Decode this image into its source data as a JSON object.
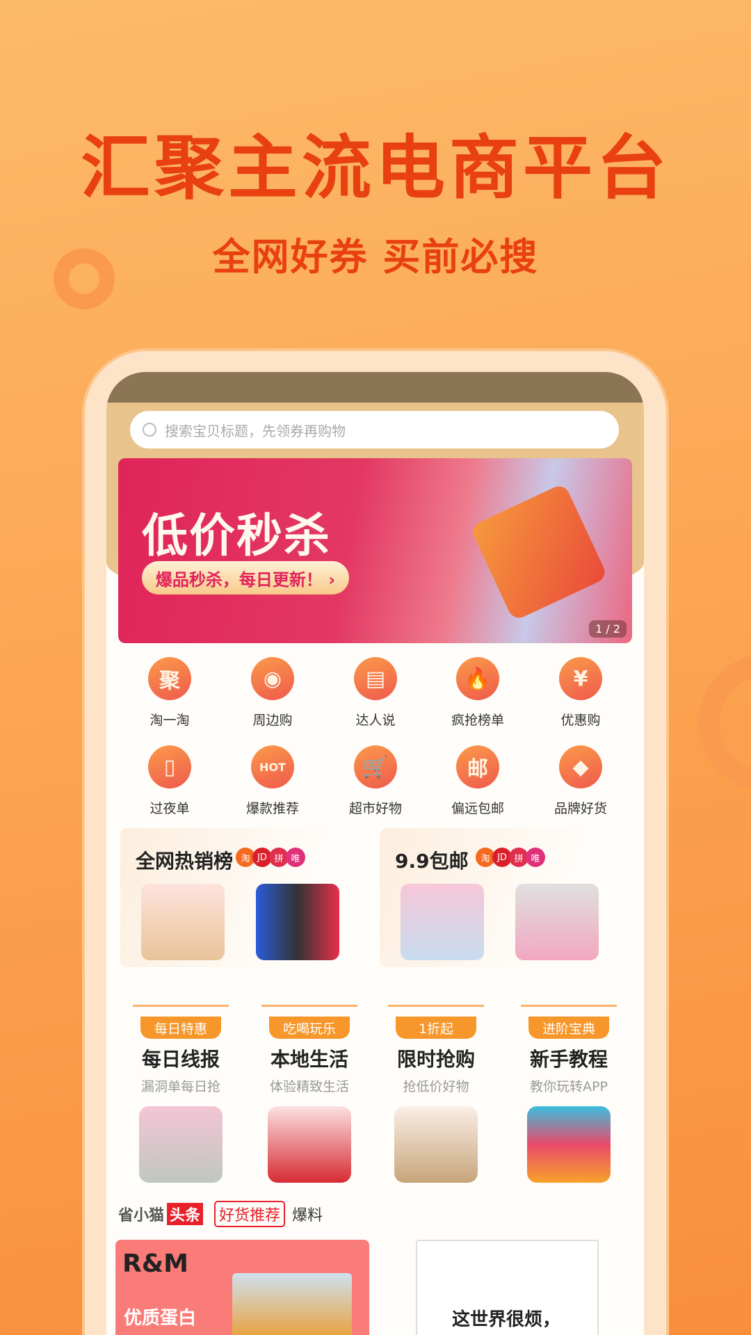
{
  "hero": {
    "title": "汇聚主流电商平台",
    "subtitle": "全网好券 买前必搜"
  },
  "search": {
    "placeholder": "搜索宝贝标题，先领券再购物"
  },
  "banner": {
    "title": "低价秒杀",
    "cta": "爆品秒杀，每日更新！ ›",
    "pager": "1 / 2"
  },
  "grid": [
    {
      "label": "淘一淘",
      "glyph": "聚",
      "icon": "gather-icon"
    },
    {
      "label": "周边购",
      "glyph": "◉",
      "icon": "location-pin-icon"
    },
    {
      "label": "达人说",
      "glyph": "▤",
      "icon": "chat-bubble-icon"
    },
    {
      "label": "疯抢榜单",
      "glyph": "🔥",
      "icon": "flame-icon"
    },
    {
      "label": "优惠购",
      "glyph": "¥",
      "icon": "money-bag-icon"
    },
    {
      "label": "过夜单",
      "glyph": "▯",
      "icon": "document-icon"
    },
    {
      "label": "爆款推荐",
      "glyph": "HOT",
      "icon": "hot-bubble-icon"
    },
    {
      "label": "超市好物",
      "glyph": "🛒",
      "icon": "shopping-cart-icon"
    },
    {
      "label": "偏远包邮",
      "glyph": "邮",
      "icon": "post-icon"
    },
    {
      "label": "品牌好货",
      "glyph": "◆",
      "icon": "diamond-icon"
    }
  ],
  "cards": [
    {
      "title": "全网热销榜"
    },
    {
      "title": "9.9包邮"
    }
  ],
  "platform_badges": [
    {
      "label": "淘",
      "color": "#f56a1e"
    },
    {
      "label": "JD",
      "color": "#d91f2a"
    },
    {
      "label": "拼",
      "color": "#e02e4e"
    },
    {
      "label": "唯",
      "color": "#e0307a"
    }
  ],
  "columns": [
    {
      "tag": "每日特惠",
      "title": "每日线报",
      "subtitle": "漏洞单每日抢"
    },
    {
      "tag": "吃喝玩乐",
      "title": "本地生活",
      "subtitle": "体验精致生活"
    },
    {
      "tag": "1折起",
      "title": "限时抢购",
      "subtitle": "抢低价好物"
    },
    {
      "tag": "进阶宝典",
      "title": "新手教程",
      "subtitle": "教你玩转APP"
    }
  ],
  "news": {
    "brand": "省小猫",
    "hot": "头条",
    "recommend": "好货推荐",
    "tip": "爆料"
  },
  "feed": [
    {
      "logo": "R&M",
      "text": "优质蛋白"
    },
    {
      "text": "这世界很烦，"
    }
  ],
  "colors": {
    "accent": "#e8400f",
    "orange": "#f7962a",
    "header": "#e8c48c"
  }
}
